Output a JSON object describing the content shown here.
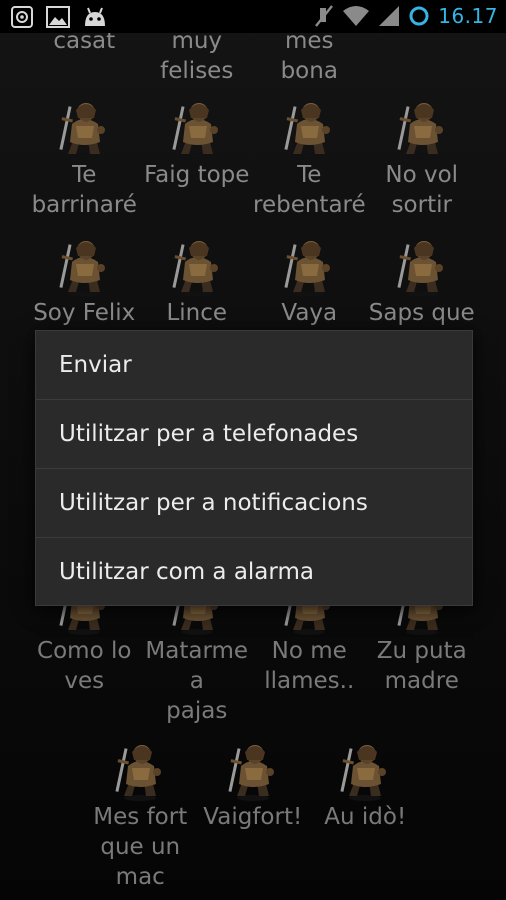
{
  "status_bar": {
    "time": "16.17",
    "icons_left": [
      "settings-icon",
      "image-icon",
      "android-icon"
    ],
    "icons_right": [
      "mute-icon",
      "wifi-icon",
      "signal-icon",
      "sync-icon"
    ],
    "accent": "#33b5e5"
  },
  "sounds": {
    "row0": [
      "casat",
      "muy\nfelises",
      "mes bona"
    ],
    "row1": [
      "Te\nbarrinaré",
      "Faig tope",
      "Te\nrebentaré",
      "No vol\nsortir"
    ],
    "row2": [
      "Soy Felix",
      "Lince",
      "Vaya",
      "Saps que"
    ],
    "row3": [
      "Como lo\nves",
      "Matarme\na\npajas",
      "No me\nllames..",
      "Zu puta\nmadre"
    ],
    "row4": [
      "Mes fort\nque un\nmac",
      "Vaigfort!",
      "Au idò!"
    ]
  },
  "context_menu": {
    "items": [
      "Enviar",
      "Utilitzar per a telefonades",
      "Utilitzar per a notificacions",
      "Utilitzar com a alarma"
    ]
  }
}
